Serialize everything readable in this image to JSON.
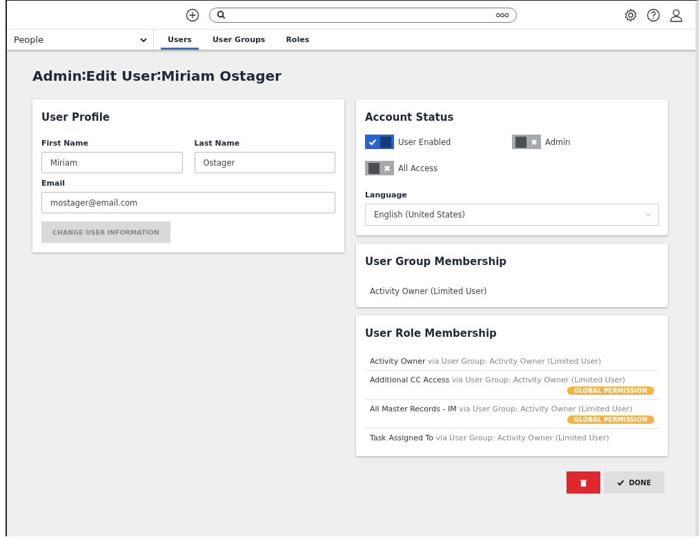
{
  "module_menu": {
    "label": "People"
  },
  "tabs": [
    {
      "label": "Users",
      "selected": true
    },
    {
      "label": "User Groups",
      "selected": false
    },
    {
      "label": "Roles",
      "selected": false
    }
  ],
  "page_title": "Admin∶Edit User∶Miriam Ostager",
  "user_profile": {
    "title": "User Profile",
    "fields": [
      {
        "label": "First Name",
        "value": "Miriam"
      },
      {
        "label": "Last Name",
        "value": "Ostager"
      },
      {
        "label": "Email",
        "value": "mostager@email.com"
      }
    ],
    "button": {
      "label": "CHANGE USER INFORMATION",
      "disabled": true
    }
  },
  "account_status": {
    "title": "Account Status",
    "toggles": [
      {
        "label": "User Enabled",
        "checked": true
      },
      {
        "label": "Admin",
        "checked": false
      },
      {
        "label": "All Access",
        "checked": false
      }
    ],
    "language": {
      "label": "Language",
      "value": "English (United States)"
    }
  },
  "group_membership": {
    "title": "User Group Membership",
    "items": [
      "Activity Owner (Limited User)"
    ]
  },
  "role_membership": {
    "title": "User Role Membership",
    "items": [
      {
        "role": "Activity Owner",
        "via": "via User Group: Activity Owner (Limited User)"
      },
      {
        "role": "Additional CC Access",
        "via": "via User Group: Activity Owner (Limited User)",
        "badge": "GLOBAL PERMISSION"
      },
      {
        "role": "All Master Records - IM",
        "via": "via User Group: Activity Owner (Limited User)",
        "badge": "GLOBAL PERMISSION"
      },
      {
        "role": "Task Assigned To",
        "via": "via User Group: Activity Owner (Limited User)"
      }
    ]
  },
  "actions": {
    "done": "DONE"
  }
}
